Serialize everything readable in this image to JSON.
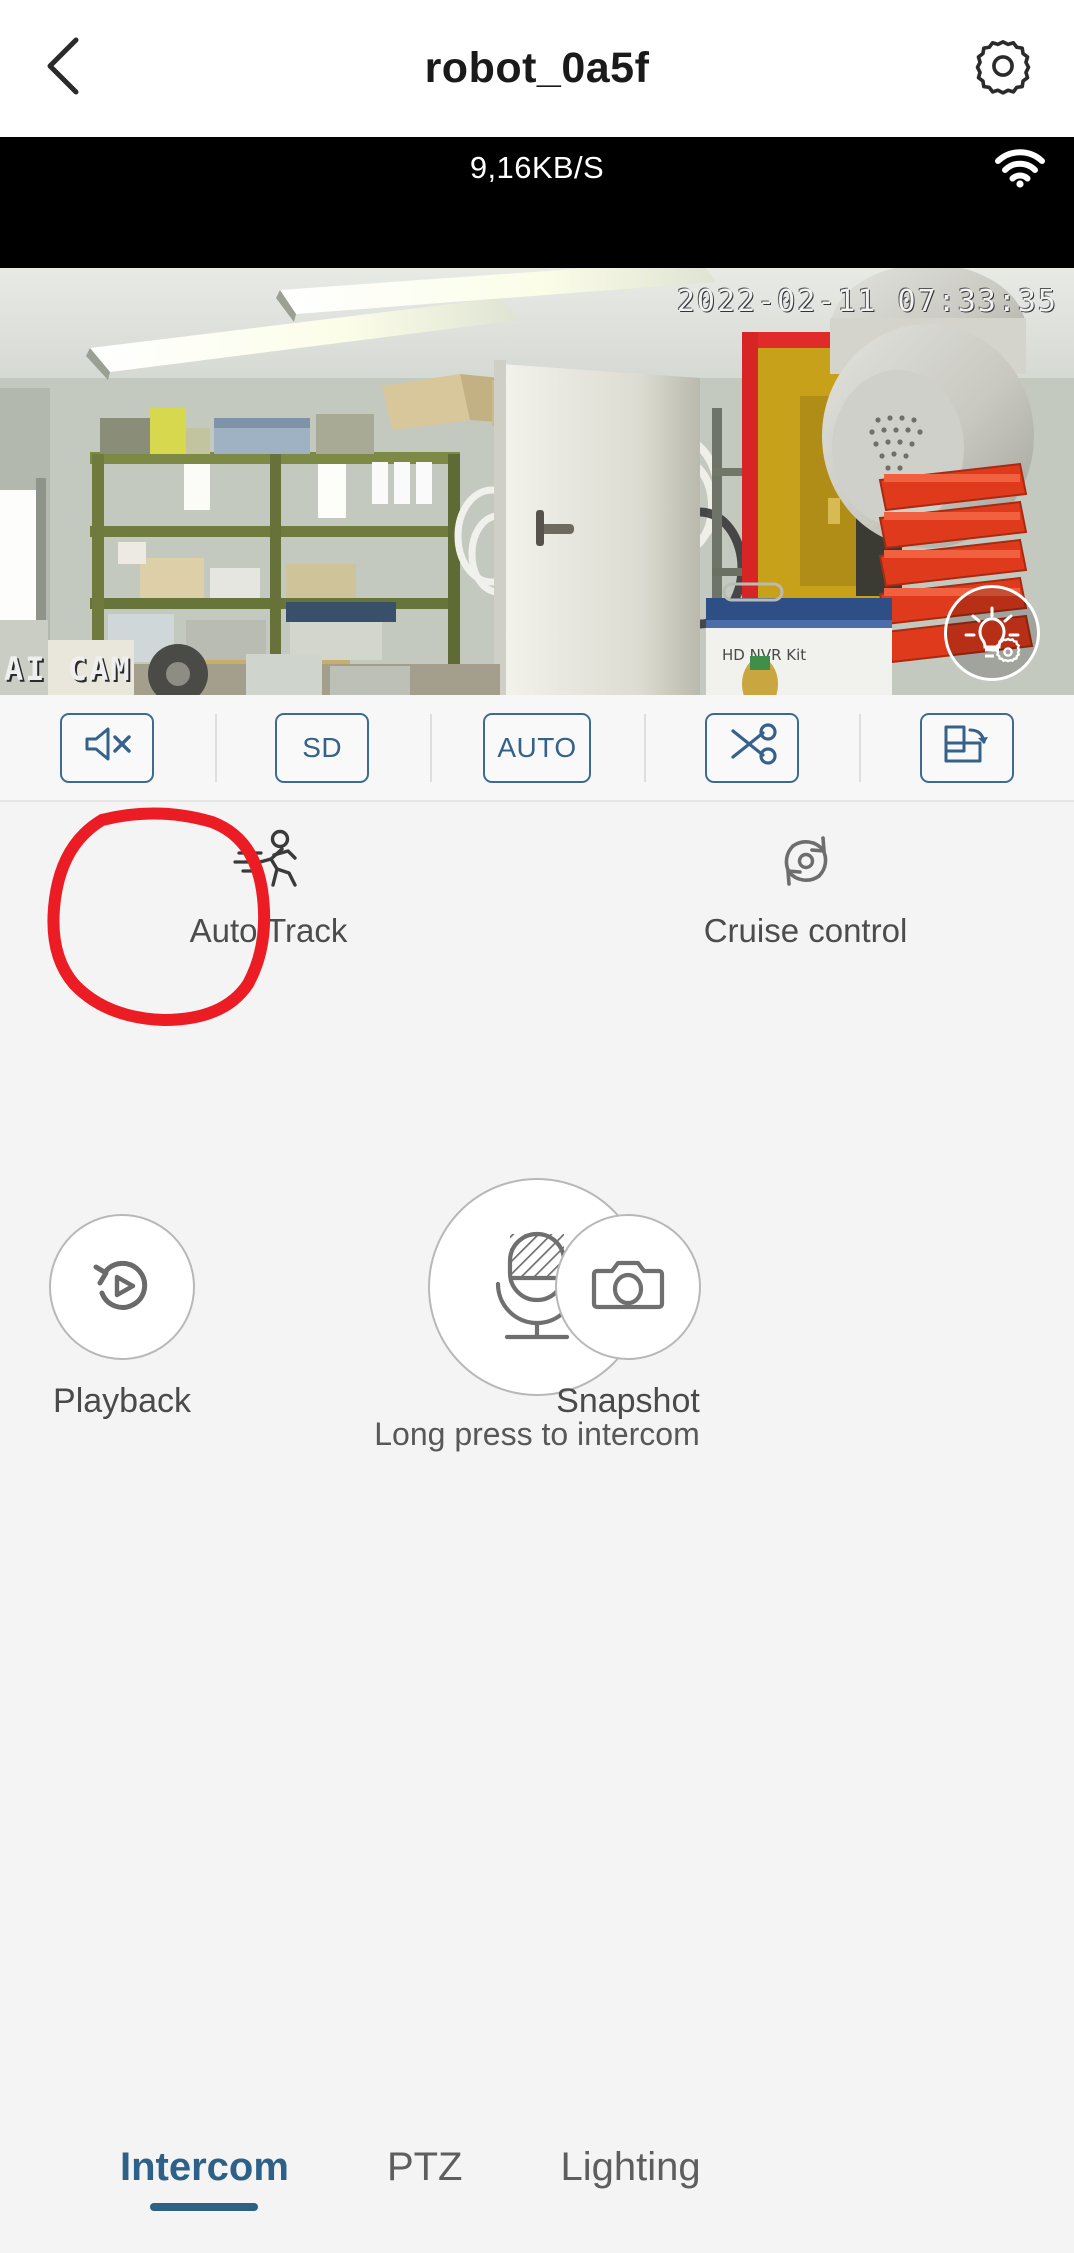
{
  "header": {
    "title": "robot_0a5f",
    "back_icon": "chevron-left-icon",
    "settings_icon": "gear-icon"
  },
  "status": {
    "bandwidth": "9,16KB/S",
    "wifi_icon": "wifi-icon",
    "wifi_strength": 3
  },
  "video": {
    "timestamp": "2022-02-11 07:33:35",
    "watermark": "AI CAM",
    "light_button_icon": "lightbulb-gear-icon",
    "scene": "indoor storage room with shelving, boxes, PTZ dome camera and red parts bins"
  },
  "toolbar": {
    "buttons": [
      {
        "name": "mute-button",
        "icon": "speaker-mute-icon",
        "label": ""
      },
      {
        "name": "quality-button",
        "icon": "text-icon",
        "label": "SD"
      },
      {
        "name": "auto-button",
        "icon": "text-icon",
        "label": "AUTO"
      },
      {
        "name": "clip-button",
        "icon": "scissors-icon",
        "label": ""
      },
      {
        "name": "rotate-button",
        "icon": "screen-rotate-icon",
        "label": ""
      }
    ]
  },
  "features": [
    {
      "name": "auto-track",
      "label": "Auto Track",
      "icon": "running-person-icon",
      "annotated": true
    },
    {
      "name": "cruise-control",
      "label": "Cruise control",
      "icon": "rotate-circle-icon",
      "annotated": false
    }
  ],
  "annotation": {
    "color": "#ec1c24",
    "shape": "hand-drawn-circle",
    "target": "Auto Track"
  },
  "controls": {
    "playback": {
      "label": "Playback",
      "icon": "replay-play-icon"
    },
    "intercom": {
      "label": "Long press to intercom",
      "icon": "microphone-icon"
    },
    "snapshot": {
      "label": "Snapshot",
      "icon": "camera-icon"
    }
  },
  "tabs": [
    {
      "label": "Intercom",
      "active": true
    },
    {
      "label": "PTZ",
      "active": false
    },
    {
      "label": "Lighting",
      "active": false
    }
  ],
  "colors": {
    "accent": "#2e6188",
    "toolbar_accent": "#35618a",
    "annotation_red": "#ec1c24",
    "page_bg": "#f4f4f4",
    "status_bg": "#000000"
  }
}
